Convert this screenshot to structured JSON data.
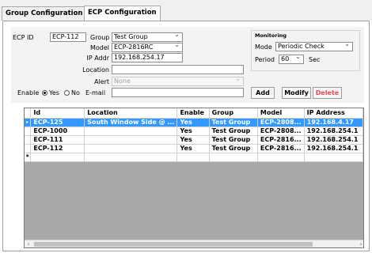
{
  "tabs": [
    {
      "label": "Group Configuration"
    },
    {
      "label": "ECP Configuration"
    }
  ],
  "form": {
    "ecp_id_label": "ECP ID",
    "ecp_id_value": "ECP-112",
    "group_label": "Group",
    "group_value": "Test Group",
    "model_label": "Model",
    "model_value": "ECP-2816RC",
    "ip_label": "IP Addr",
    "ip_value": "192.168.254.17",
    "location_label": "Location",
    "location_value": "",
    "alert_label": "Alert",
    "alert_value": "None",
    "enable_label": "Enable",
    "yes_label": "Yes",
    "no_label": "No",
    "email_label": "E-mail",
    "email_value": "",
    "enable_selected": "Yes"
  },
  "monitoring": {
    "title": "Monitoring",
    "mode_label": "Mode",
    "mode_value": "Periodic Check",
    "period_label": "Period",
    "period_value": "60",
    "unit": "Sec"
  },
  "buttons": {
    "add": "Add",
    "modify": "Modify",
    "delete": "Delete",
    "delete_color": "#e24b5c"
  },
  "table": {
    "columns": [
      "Id",
      "Location",
      "Enable",
      "Group",
      "Model",
      "IP Address"
    ],
    "rows": [
      {
        "id": "ECP-125",
        "location": "South Window Side @ ...",
        "enable": "Yes",
        "group": "Test Group",
        "model": "ECP-2808...",
        "ip": "192.168.4.17",
        "selected": true
      },
      {
        "id": "ECP-1000",
        "location": "",
        "enable": "Yes",
        "group": "Test Group",
        "model": "ECP-2808...",
        "ip": "192.168.254.1"
      },
      {
        "id": "ECP-111",
        "location": "",
        "enable": "Yes",
        "group": "Test Group",
        "model": "ECP-2816...",
        "ip": "192.168.254.1"
      },
      {
        "id": "ECP-112",
        "location": "",
        "enable": "Yes",
        "group": "Test Group",
        "model": "ECP-2816...",
        "ip": "192.168.254.1"
      }
    ],
    "selection_color": "#3399ff"
  }
}
